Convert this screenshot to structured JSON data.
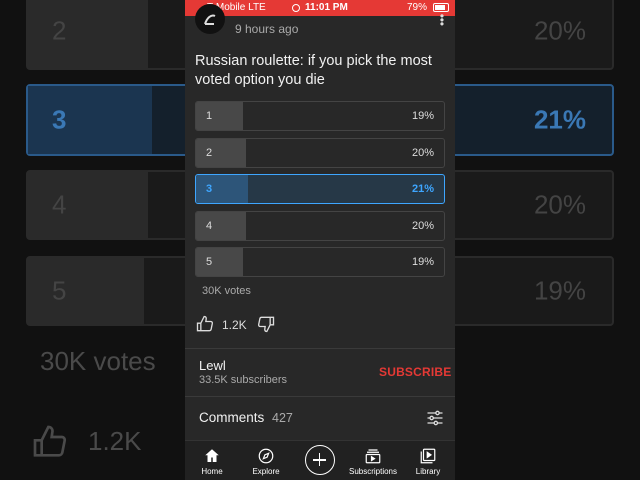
{
  "status_bar": {
    "carrier": "T-Mobile  LTE",
    "time": "11:01 PM",
    "battery": "79%"
  },
  "post": {
    "time_ago": "9 hours ago",
    "title": "Russian roulette: if you pick the most voted option you die",
    "menu_icon": "more-vertical-icon"
  },
  "poll": {
    "options": [
      {
        "label": "1",
        "percent": "19%",
        "fill": 0.19,
        "selected": false
      },
      {
        "label": "2",
        "percent": "20%",
        "fill": 0.2,
        "selected": false
      },
      {
        "label": "3",
        "percent": "21%",
        "fill": 0.21,
        "selected": true
      },
      {
        "label": "4",
        "percent": "20%",
        "fill": 0.2,
        "selected": false
      },
      {
        "label": "5",
        "percent": "19%",
        "fill": 0.19,
        "selected": false
      }
    ],
    "votes": "30K votes"
  },
  "engagement": {
    "likes": "1.2K"
  },
  "channel": {
    "name": "Lewl",
    "subscribers": "33.5K subscribers",
    "subscribe_label": "SUBSCRIBE"
  },
  "comments": {
    "label": "Comments",
    "count": "427"
  },
  "bottom_nav": {
    "home": "Home",
    "explore": "Explore",
    "subscriptions": "Subscriptions",
    "library": "Library"
  },
  "colors": {
    "accent_red": "#e53935",
    "selected_blue": "#3ea6ff"
  }
}
